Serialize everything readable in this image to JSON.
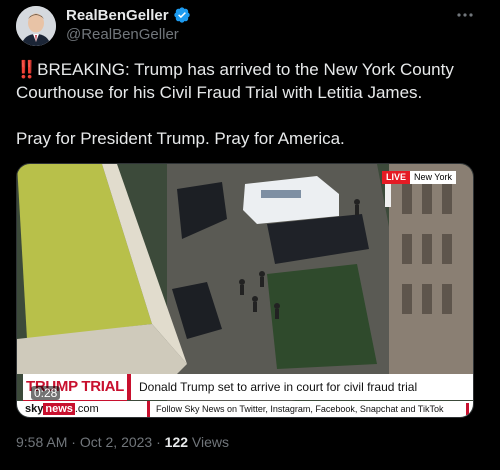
{
  "author": {
    "display_name": "RealBenGeller",
    "handle": "@RealBenGeller",
    "verified": true,
    "verified_color": "#1d9bf0"
  },
  "more_icon": "more-horizontal-icon",
  "tweet": {
    "alert_emoji": "‼️",
    "line1": "BREAKING: Trump has arrived to the New York County Courthouse for his Civil Fraud Trial with Letitia James.",
    "line2": "Pray for President Trump. Pray for America."
  },
  "video": {
    "live_label": "LIVE",
    "location": "New York",
    "timestamp": "0:28",
    "lower_third": {
      "tag": "TRUMP TRIAL",
      "headline": "Donald Trump set to arrive in court for civil fraud trial",
      "logo_sky": "sky",
      "logo_news": "news",
      "logo_com": ".com",
      "ticker": "Follow Sky News on Twitter, Instagram, Facebook, Snapchat and TikTok"
    }
  },
  "meta": {
    "time": "9:58 AM",
    "separator": "·",
    "date": "Oct 2, 2023",
    "views_count": "122",
    "views_label": "Views"
  },
  "colors": {
    "background": "#000000",
    "text": "#e7e9ea",
    "secondary": "#71767b",
    "sky_red": "#c8102e"
  }
}
